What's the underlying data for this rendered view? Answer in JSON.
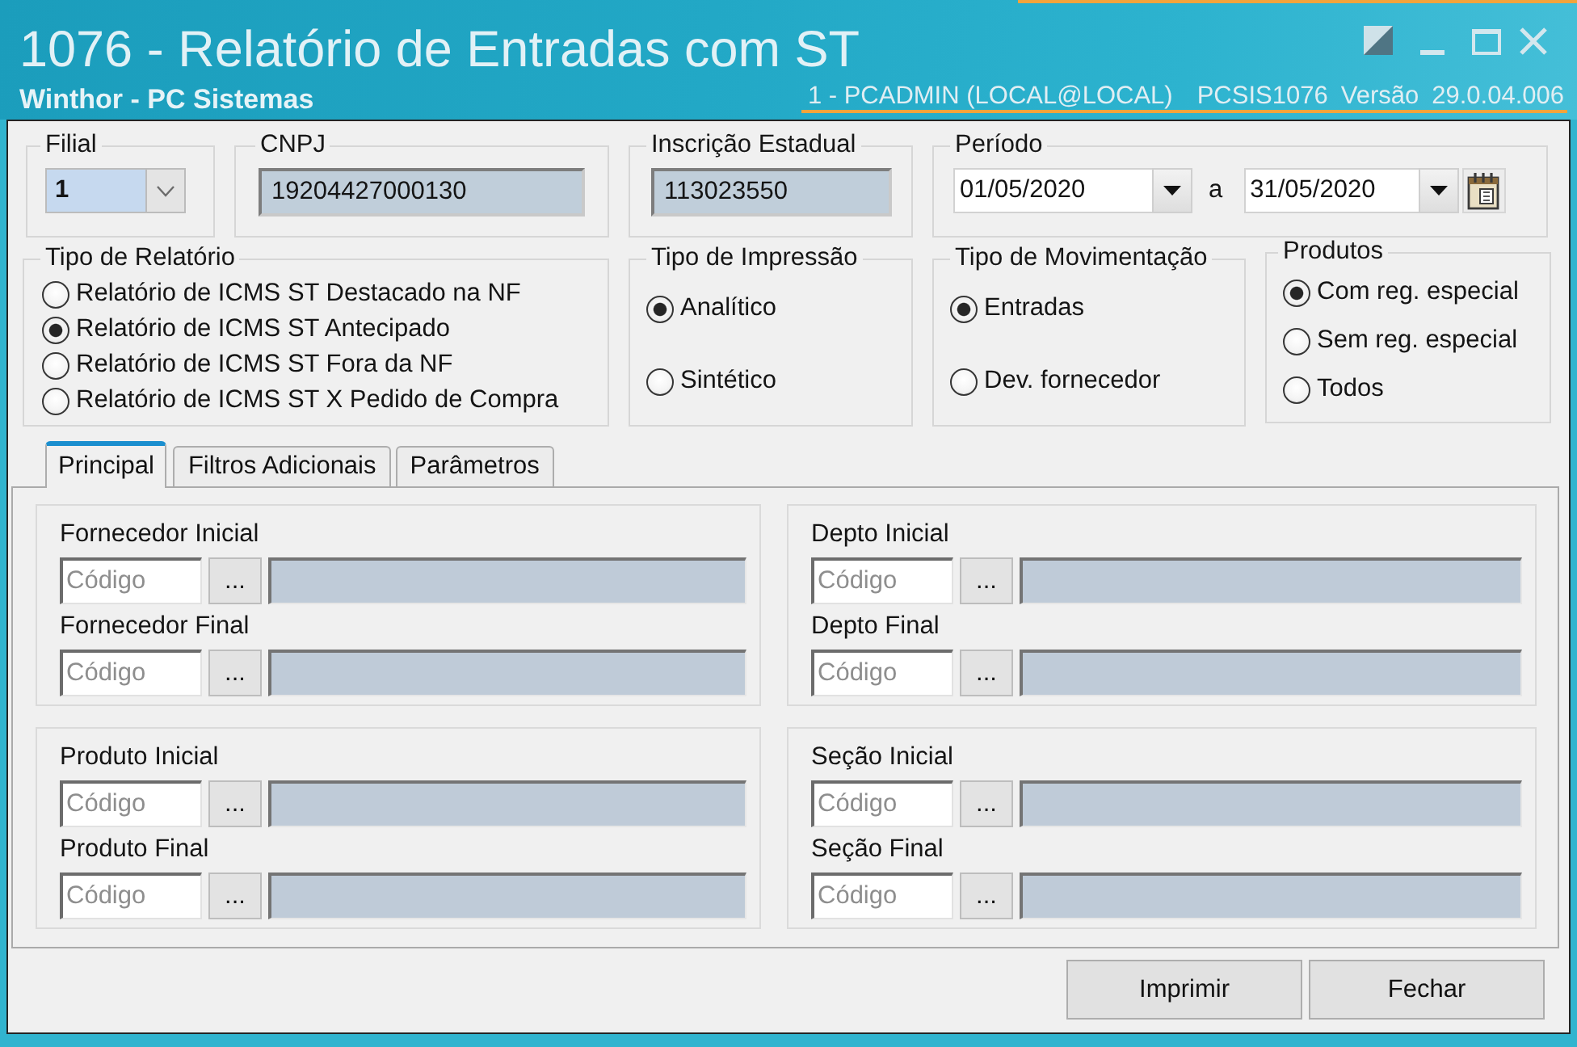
{
  "window": {
    "title": "1076 - Relatório de Entradas com ST",
    "subtitle": "Winthor - PC Sistemas",
    "user": "1 - PCADMIN (LOCAL@LOCAL)",
    "program": "PCSIS1076",
    "version_label": "Versão",
    "version": "29.0.04.006"
  },
  "filial": {
    "label": "Filial",
    "value": "1"
  },
  "cnpj": {
    "label": "CNPJ",
    "value": "19204427000130"
  },
  "inscricao_estadual": {
    "label": "Inscrição Estadual",
    "value": "113023550"
  },
  "periodo": {
    "label": "Período",
    "start": "01/05/2020",
    "separator": "a",
    "end": "31/05/2020"
  },
  "option_groups": [
    {
      "title": "Tipo de Relatório",
      "options": [
        {
          "label": "Relatório de ICMS ST Destacado na NF",
          "selected": false
        },
        {
          "label": "Relatório de ICMS ST Antecipado",
          "selected": true
        },
        {
          "label": "Relatório de ICMS ST Fora da NF",
          "selected": false
        },
        {
          "label": "Relatório de ICMS ST X Pedido de Compra",
          "selected": false
        }
      ]
    },
    {
      "title": "Tipo de Impressão",
      "options": [
        {
          "label": "Analítico",
          "selected": true
        },
        {
          "label": "Sintético",
          "selected": false
        }
      ]
    },
    {
      "title": "Tipo de Movimentação",
      "options": [
        {
          "label": "Entradas",
          "selected": true
        },
        {
          "label": "Dev. fornecedor",
          "selected": false
        }
      ]
    },
    {
      "title": "Produtos",
      "options": [
        {
          "label": "Com reg. especial",
          "selected": true
        },
        {
          "label": "Sem reg. especial",
          "selected": false
        },
        {
          "label": "Todos",
          "selected": false
        }
      ]
    }
  ],
  "tabs": [
    {
      "label": "Principal",
      "selected": true
    },
    {
      "label": "Filtros Adicionais",
      "selected": false
    },
    {
      "label": "Parâmetros",
      "selected": false
    }
  ],
  "filter_groups": [
    {
      "fields": [
        {
          "label": "Fornecedor Inicial",
          "placeholder": "Código",
          "button": "..."
        },
        {
          "label": "Fornecedor Final",
          "placeholder": "Código",
          "button": "..."
        }
      ]
    },
    {
      "fields": [
        {
          "label": "Depto Inicial",
          "placeholder": "Código",
          "button": "..."
        },
        {
          "label": "Depto Final",
          "placeholder": "Código",
          "button": "..."
        }
      ]
    },
    {
      "fields": [
        {
          "label": "Produto Inicial",
          "placeholder": "Código",
          "button": "..."
        },
        {
          "label": "Produto Final",
          "placeholder": "Código",
          "button": "..."
        }
      ]
    },
    {
      "fields": [
        {
          "label": "Seção Inicial",
          "placeholder": "Código",
          "button": "..."
        },
        {
          "label": "Seção Final",
          "placeholder": "Código",
          "button": "..."
        }
      ]
    }
  ],
  "buttons": [
    {
      "label": "Imprimir"
    },
    {
      "label": "Fechar"
    }
  ]
}
